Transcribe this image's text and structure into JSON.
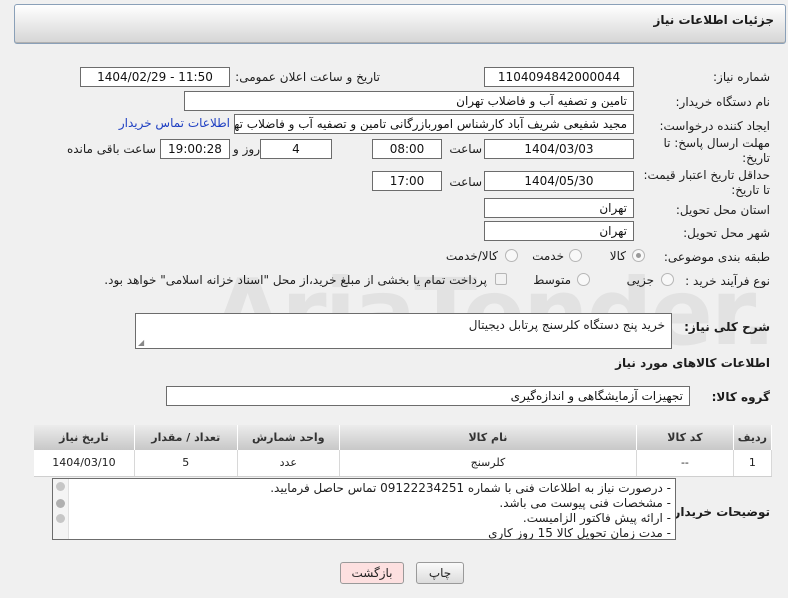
{
  "header": {
    "title": "جزئیات اطلاعات نیاز"
  },
  "need_number": {
    "label": "شماره نیاز:",
    "value": "1104094842000044"
  },
  "announce": {
    "label": "تاریخ و ساعت اعلان عمومی:",
    "value": "1404/02/29 - 11:50"
  },
  "buyer_org": {
    "label": "نام دستگاه خریدار:",
    "value": "تامین و تصفیه آب و فاضلاب تهران"
  },
  "creator": {
    "label": "ایجاد کننده درخواست:",
    "value": "مجید شفیعی شریف آباد کارشناس اموربازرگانی تامین و تصفیه آب و فاضلاب تهران",
    "contact_link": "اطلاعات تماس خریدار"
  },
  "deadline": {
    "label_line1": "مهلت ارسال پاسخ: تا",
    "label_line2": "تاریخ:",
    "date": "1404/03/03",
    "time_label": "ساعت",
    "time": "08:00",
    "days": "4",
    "days_label": "روز و",
    "remaining": "19:00:28",
    "remaining_label": "ساعت باقی مانده"
  },
  "validity": {
    "label_line1": "حداقل تاریخ اعتبار قیمت:",
    "label_line2": "تا تاریخ:",
    "date": "1404/05/30",
    "time_label": "ساعت",
    "time": "17:00"
  },
  "province": {
    "label": "استان محل تحویل:",
    "value": "تهران"
  },
  "city": {
    "label": "شهر محل تحویل:",
    "value": "تهران"
  },
  "category": {
    "label": "طبقه بندی موضوعی:",
    "options": [
      "کالا",
      "خدمت",
      "کالا/خدمت"
    ],
    "selected": "کالا"
  },
  "process": {
    "label": "نوع فرآیند خرید :",
    "options": [
      "جزیی",
      "متوسط"
    ],
    "note": "پرداخت تمام یا بخشی از مبلغ خرید،از محل \"اسناد خزانه اسلامی\" خواهد بود."
  },
  "description": {
    "label": "شرح کلی نیاز:",
    "value": "خرید پنج دستگاه کلرسنج پرتابل دیجیتال"
  },
  "goods_section": {
    "title": "اطلاعات کالاهای مورد نیاز"
  },
  "goods_group": {
    "label": "گروه کالا:",
    "value": "تجهیزات آزمایشگاهی و اندازه‌گیری"
  },
  "table": {
    "headers": [
      "ردیف",
      "کد کالا",
      "نام کالا",
      "واحد شمارش",
      "تعداد / مقدار",
      "تاریخ نیاز"
    ],
    "rows": [
      [
        "1",
        "--",
        "کلرسنج",
        "عدد",
        "5",
        "1404/03/10"
      ]
    ]
  },
  "buyer_notes": {
    "label": "توضیحات خریدار:",
    "lines": [
      "- درصورت نیاز به اطلاعات فنی با شماره 09122234251 تماس حاصل فرمایید.",
      "- مشخصات فنی پیوست می باشد.",
      "- ارائه پیش فاکتور الزامیست.",
      "- مدت زمان تحویل کالا 15 روز کاری"
    ]
  },
  "buttons": {
    "print": "چاپ",
    "back": "بازگشت"
  },
  "colors": {
    "link": "#1e3fc2",
    "back_button_bg": "#fde0e0"
  },
  "watermark_logo": "AriaTender.neT"
}
